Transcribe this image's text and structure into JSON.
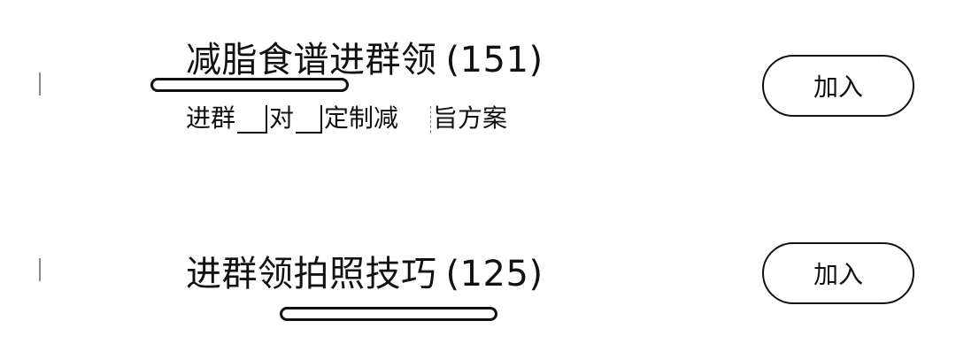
{
  "groups": [
    {
      "name": "减脂食谱进群领",
      "count": "(151)",
      "subtitle_parts": [
        "进群",
        "对",
        "定制减",
        "旨方案"
      ],
      "join_label": "加入"
    },
    {
      "name": "进群领拍照技巧",
      "count": "(125)",
      "join_label": "加入"
    }
  ]
}
